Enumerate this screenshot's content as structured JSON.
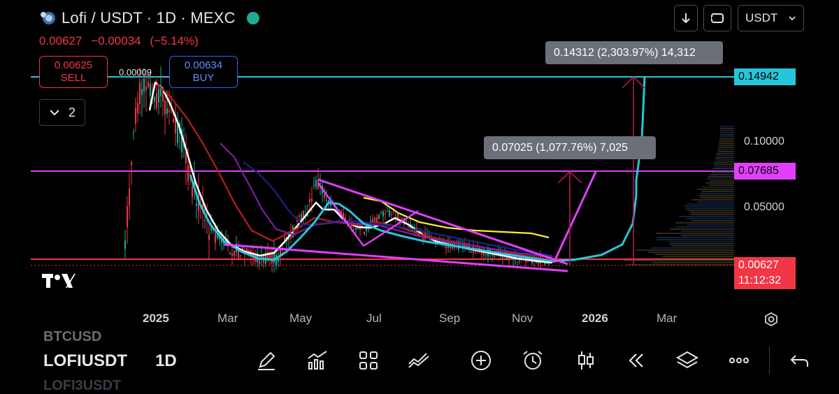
{
  "header": {
    "symbol_title": "Lofi / USDT · 1D · MEXC",
    "last_price": "0.00627",
    "change": "−0.00034",
    "change_pct": "(−5.14%)"
  },
  "trade": {
    "sell_price": "0.00625",
    "sell_label": "SELL",
    "buy_price": "0.00634",
    "buy_label": "BUY",
    "spread": "0.00009"
  },
  "indicators": {
    "count": "2"
  },
  "toolbar_top": {
    "currency": "USDT"
  },
  "measurements": [
    {
      "text": "0.14312 (2,303.97%) 14,312"
    },
    {
      "text": "0.07025 (1,077.76%) 7,025"
    }
  ],
  "price_scale": {
    "labels": [
      "0.10000",
      "0.05000"
    ],
    "tags": {
      "cyan": "0.14942",
      "magenta": "0.07685",
      "current": "0.00627",
      "countdown": "11:12:32"
    }
  },
  "time_scale": {
    "labels": [
      "2025",
      "Mar",
      "May",
      "Jul",
      "Sep",
      "Nov",
      "2026",
      "Mar"
    ]
  },
  "bottom": {
    "symbols": [
      "BTCUSD",
      "LOFIUSDT",
      "LOFI3USDT"
    ],
    "timeframe": "1D",
    "tools": [
      "drawing-pen-icon",
      "indicators-icon",
      "layout-grid-icon",
      "compare-icon",
      "add-icon",
      "alert-clock-icon",
      "candle-type-icon",
      "replay-icon",
      "layers-icon",
      "more-icon",
      "back-icon"
    ]
  },
  "colors": {
    "background": "#000000",
    "up": "#22ab94",
    "down": "#f23645",
    "cyan_level": "#26c6da",
    "magenta_level": "#e040fb",
    "current_price": "#f23645"
  }
}
